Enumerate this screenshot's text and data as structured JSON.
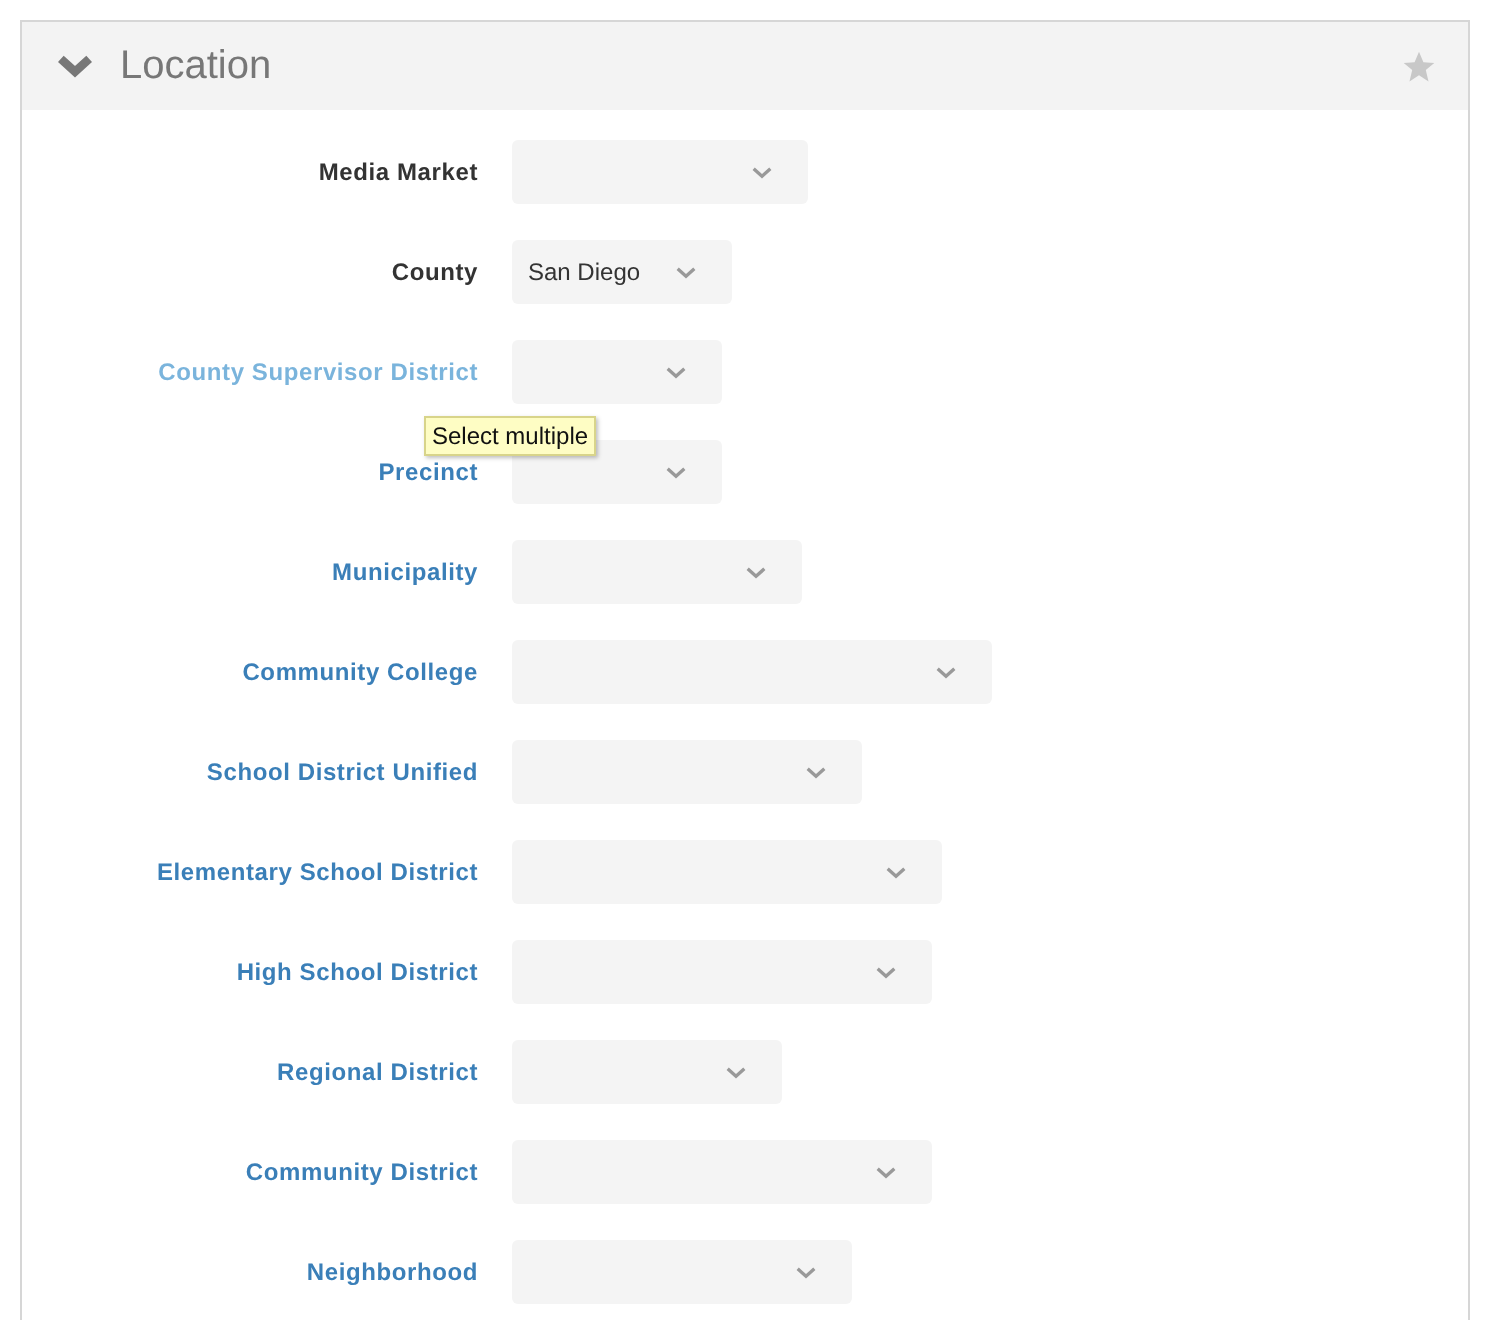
{
  "panel": {
    "title": "Location",
    "expanded": true,
    "starred": false
  },
  "fields": [
    {
      "label": "Media Market",
      "kind": "plain"
    },
    {
      "label": "County",
      "kind": "plain",
      "value": "San Diego"
    },
    {
      "label": "County Supervisor District",
      "kind": "hovered"
    },
    {
      "label": "Precinct",
      "kind": "link",
      "tooltip": "Select multiple"
    },
    {
      "label": "Municipality",
      "kind": "link"
    },
    {
      "label": "Community College",
      "kind": "link"
    },
    {
      "label": "School District Unified",
      "kind": "link"
    },
    {
      "label": "Elementary School District",
      "kind": "link"
    },
    {
      "label": "High School District",
      "kind": "link"
    },
    {
      "label": "Regional District",
      "kind": "link"
    },
    {
      "label": "Community District",
      "kind": "link"
    },
    {
      "label": "Neighborhood",
      "kind": "link"
    }
  ]
}
